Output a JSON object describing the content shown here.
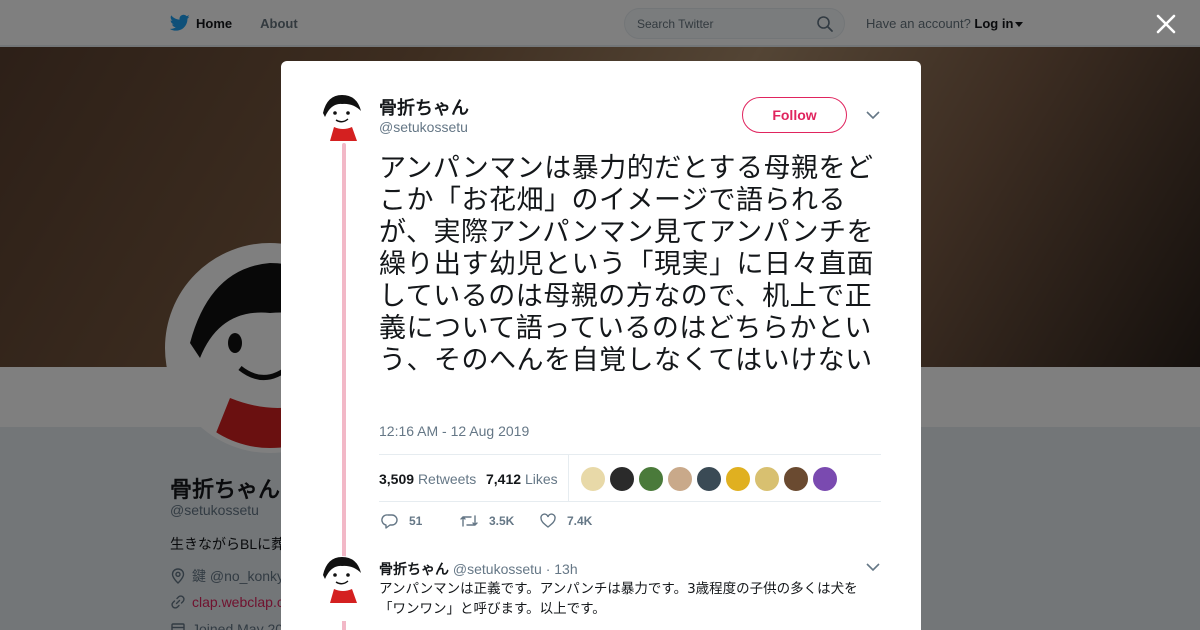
{
  "nav": {
    "home_label": "Home",
    "about_label": "About",
    "search_placeholder": "Search Twitter",
    "account_prompt": "Have an account?",
    "login_label": "Log in"
  },
  "profile": {
    "name": "骨折ちゃん",
    "handle": "@setukossetu",
    "bio": "生きながらBLに葬",
    "location": "鍵 @no_konky",
    "link": "clap.webclap.c",
    "joined": "Joined May 20"
  },
  "tweet": {
    "author_name": "骨折ちゃん",
    "author_handle": "@setukossetu",
    "follow_label": "Follow",
    "text": "アンパンマンは暴力的だとする母親をどこか「お花畑」のイメージで語られるが、実際アンパンマン見てアンパンチを繰り出す幼児という「現実」に日々直面しているのは母親の方なので、机上で正義について語っているのはどちらかという、そのへんを自覚しなくてはいけない",
    "timestamp": "12:16 AM - 12 Aug 2019",
    "retweets_count": "3,509",
    "retweets_label": "Retweets",
    "likes_count": "7,412",
    "likes_label": "Likes",
    "actions": {
      "reply_count": "51",
      "retweet_count": "3.5K",
      "like_count": "7.4K"
    },
    "likers": [
      "#e8d9a8",
      "#2a2a2a",
      "#4a7a3a",
      "#c9a98a",
      "#3a4a55",
      "#e0b020",
      "#d8c070",
      "#6a4a30",
      "#7a4ab0"
    ]
  },
  "reply": {
    "author_name": "骨折ちゃん",
    "author_handle": "@setukossetu",
    "time": "· 13h",
    "text": "アンパンマンは正義です。アンパンチは暴力です。3歳程度の子供の多くは犬を「ワンワン」と呼びます。以上です。"
  },
  "colors": {
    "accent": "#e0245e",
    "thread_line": "#f2b8c7",
    "twitter_blue": "#1da1f2"
  }
}
